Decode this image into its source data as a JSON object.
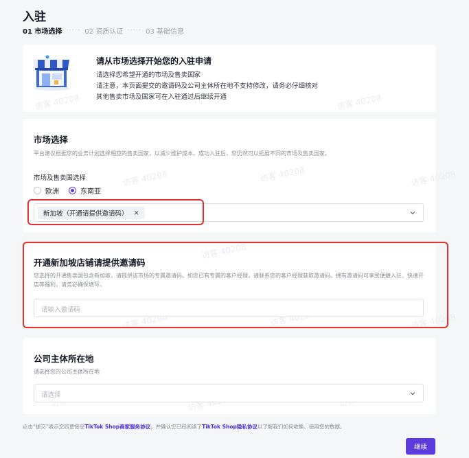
{
  "header": {
    "title": "入驻",
    "steps": [
      "01 市场选择",
      "02 资质认证",
      "03 基础信息"
    ],
    "step_dots": "·····"
  },
  "intro": {
    "title": "请从市场选择开始您的入驻申请",
    "lines": [
      "请选择您希望开通的市场及售卖国家",
      "请注意，本页面提交的邀请码及公司主体所在地不支持修改，请务必仔细核对",
      "其他售卖市场及国家可在入驻通过后继续开通"
    ]
  },
  "market": {
    "title": "市场选择",
    "desc": "平台建议根据您的业务计划选择相应的售卖国家，以减少维护成本。成功入驻后，您仍然可以拓展不同的市场及售卖国家。",
    "field_label": "市场及售卖国选择",
    "options": [
      {
        "label": "欧洲",
        "checked": false
      },
      {
        "label": "东南亚",
        "checked": true
      }
    ],
    "selected_tag": "新加坡（开通请提供邀请码）",
    "tag_remove": "×"
  },
  "invite": {
    "title": "开通新加坡店铺请提供邀请码",
    "desc": "您选择的开通售卖国包含新加坡，请提供该市场的专属邀请码。如您已有专属的客户经理，请联系您的客户经理获取邀请码。拥有邀请码可享受便捷入驻、快速开店等福利，请务必确保填写。",
    "placeholder": "请输入邀请码"
  },
  "company": {
    "title": "公司主体所在地",
    "desc": "请选择您的公司主体所在地",
    "placeholder": "请选择"
  },
  "footer": {
    "prefix": "点击“提交”表示您同意接受",
    "link1": "TikTok Shop商家服务协议",
    "middle": "，并确认您已经阅读了",
    "link2": "TikTok Shop隐私协议",
    "suffix": "以了解我们如何收集、使用您的数据。",
    "continue_label": "继续"
  },
  "watermark": "访客 40208",
  "colors": {
    "accent": "#5b3bdb",
    "highlight": "#e4312b"
  }
}
